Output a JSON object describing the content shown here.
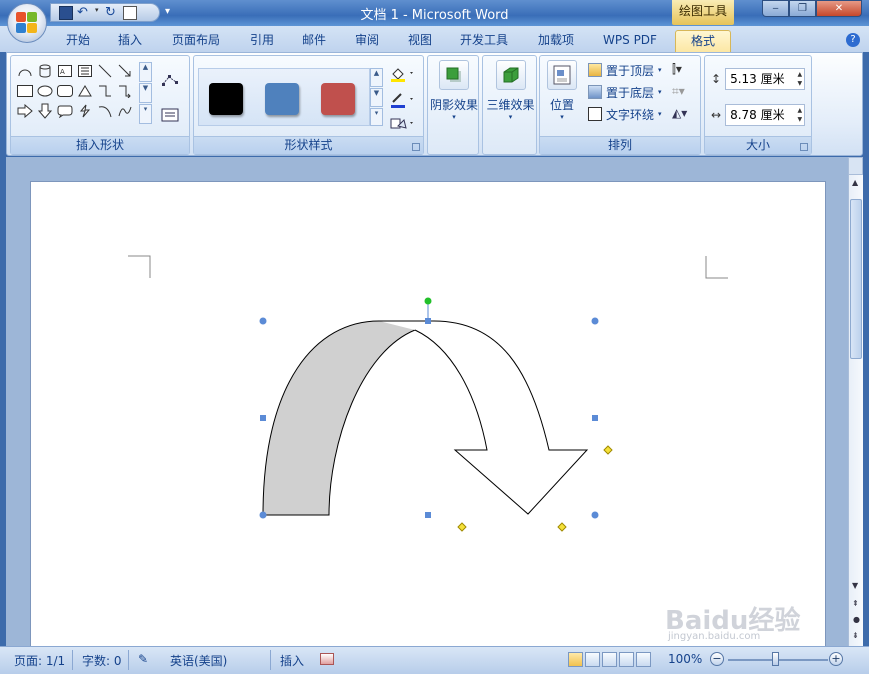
{
  "window": {
    "title": "文档 1 - Microsoft Word",
    "context_tool": "绘图工具",
    "minimize": "‒",
    "restore": "❐",
    "close": "✕"
  },
  "tabs": [
    {
      "label": "开始"
    },
    {
      "label": "插入"
    },
    {
      "label": "页面布局"
    },
    {
      "label": "引用"
    },
    {
      "label": "邮件"
    },
    {
      "label": "审阅"
    },
    {
      "label": "视图"
    },
    {
      "label": "开发工具"
    },
    {
      "label": "加载项"
    },
    {
      "label": "WPS PDF"
    },
    {
      "label": "格式",
      "active": true
    }
  ],
  "groups": {
    "insert_shapes": {
      "label": "插入形状"
    },
    "shape_styles": {
      "label": "形状样式",
      "swatches": [
        "#000000",
        "#4f81bd",
        "#c0504d"
      ]
    },
    "shadow": {
      "label": "阴影效果"
    },
    "threed": {
      "label": "三维效果"
    },
    "arrange": {
      "label": "排列",
      "position": "位置",
      "bring_front": "置于顶层",
      "send_back": "置于底层",
      "text_wrap": "文字环绕"
    },
    "size": {
      "label": "大小",
      "height": "5.13 厘米",
      "width": "8.78 厘米"
    }
  },
  "status": {
    "page": "页面: 1/1",
    "words": "字数: 0",
    "language": "英语(美国)",
    "mode": "插入",
    "zoom": "100%"
  },
  "watermark": {
    "text": "Baidu经验",
    "sub": "jingyan.baidu.com"
  },
  "colors": {
    "accent": "#15428b",
    "shape_fill": "#d0d0d0",
    "handle": "#5b8bd6",
    "rotate_handle": "#22c02a",
    "adjust_handle": "#f5e13a"
  }
}
